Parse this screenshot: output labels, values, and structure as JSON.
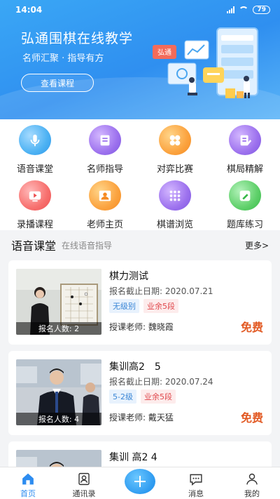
{
  "status_bar": {
    "time": "14:04",
    "battery": "79"
  },
  "banner": {
    "title": "弘通围棋在线教学",
    "subtitle": "名师汇聚 · 指导有方",
    "button": "查看课程",
    "illustration_badge": "弘通"
  },
  "categories": [
    {
      "label": "语音课堂",
      "icon": "microphone-icon"
    },
    {
      "label": "名师指导",
      "icon": "book-icon"
    },
    {
      "label": "对弈比赛",
      "icon": "clover-icon"
    },
    {
      "label": "棋局精解",
      "icon": "edit-document-icon"
    },
    {
      "label": "录播课程",
      "icon": "video-play-icon"
    },
    {
      "label": "老师主页",
      "icon": "teacher-profile-icon"
    },
    {
      "label": "棋谱浏览",
      "icon": "grid-dots-icon"
    },
    {
      "label": "题库练习",
      "icon": "pencil-note-icon"
    }
  ],
  "section": {
    "title": "语音课堂",
    "subtitle": "在线语音指导",
    "more": "更多>"
  },
  "courses": [
    {
      "title": "棋力测试",
      "date": "报名截止日期: 2020.07.21",
      "tags": [
        "无级别",
        "业余5段"
      ],
      "teacher": "授课老师: 魏晓霞",
      "price": "免费",
      "enrolled": "报名人数: 2"
    },
    {
      "title": "集训高2　5",
      "date": "报名截止日期: 2020.07.24",
      "tags": [
        "5-2级",
        "业余5段"
      ],
      "teacher": "授课老师: 戴天猛",
      "price": "免费",
      "enrolled": "报名人数: 4"
    },
    {
      "title": "集训 高2  4"
    }
  ],
  "nav": {
    "home": "首页",
    "contacts": "通讯录",
    "messages": "消息",
    "mine": "我的"
  },
  "colors": {
    "primary": "#2d8cf0",
    "price": "#e25a24",
    "tag_blue": "#3a86d6",
    "tag_red": "#e0474b"
  }
}
